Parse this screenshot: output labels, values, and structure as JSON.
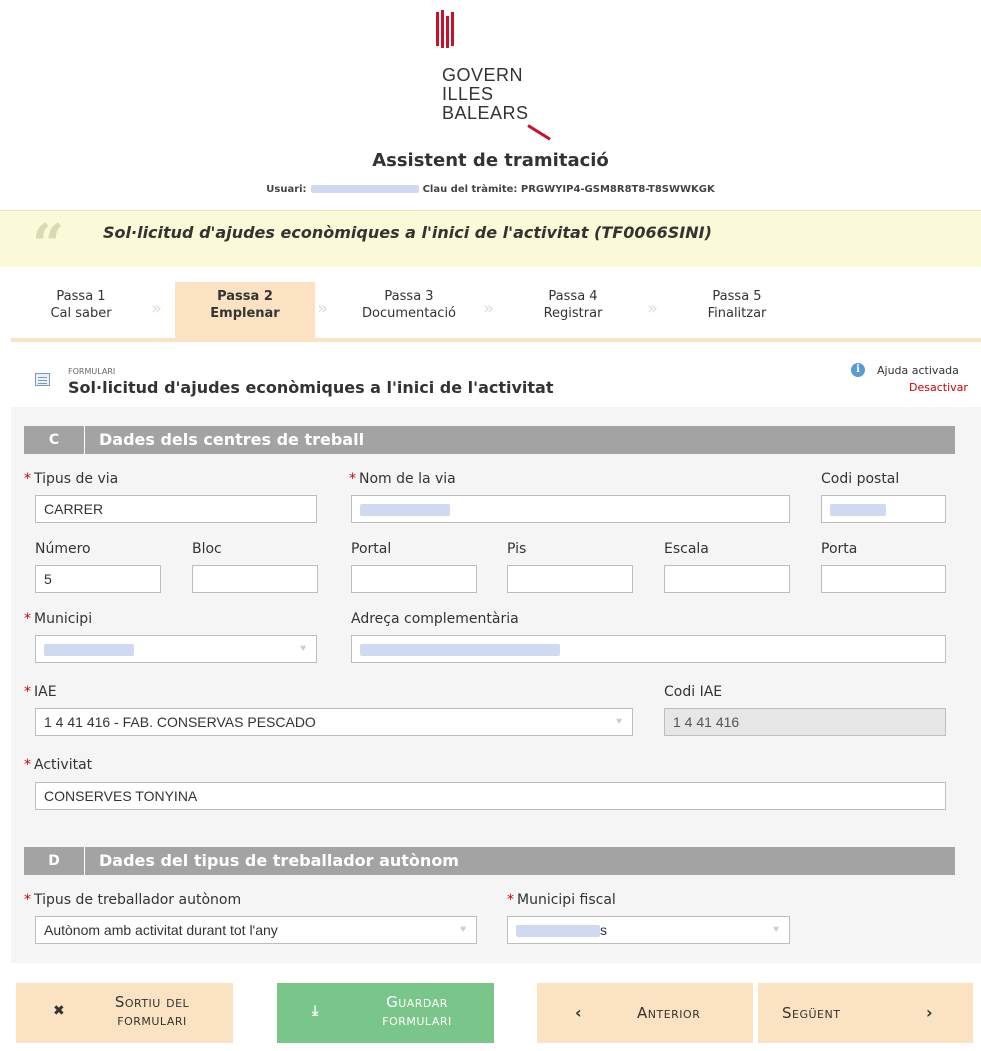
{
  "logo": {
    "line1": "GOVERN",
    "line2": "ILLES",
    "line3": "BALEARS"
  },
  "header": {
    "title": "Assistent de tramitació",
    "user_label": "Usuari:",
    "key_label": "Clau del tràmite:",
    "key_value": "PRGWYIP4-GSM8R8T8-T8SWWKGK"
  },
  "procedure": {
    "title": "Sol·licitud d'ajudes econòmiques a l'inici de l'activitat (TF0066SINI)"
  },
  "steps": [
    {
      "n": "Passa 1",
      "label": "Cal saber"
    },
    {
      "n": "Passa 2",
      "label": "Emplenar"
    },
    {
      "n": "Passa 3",
      "label": "Documentació"
    },
    {
      "n": "Passa 4",
      "label": "Registrar"
    },
    {
      "n": "Passa 5",
      "label": "Finalitzar"
    }
  ],
  "form": {
    "kicker": "FORMULARI",
    "title": "Sol·licitud d'ajudes econòmiques a l'inici de l'activitat",
    "help_on": "Ajuda activada",
    "help_off": "Desactivar"
  },
  "sectionC": {
    "letter": "C",
    "title": "Dades dels centres de treball",
    "labels": {
      "tipus_via": "Tipus de via",
      "nom_via": "Nom de la via",
      "codi_postal": "Codi postal",
      "numero": "Número",
      "bloc": "Bloc",
      "portal": "Portal",
      "pis": "Pis",
      "escala": "Escala",
      "porta": "Porta",
      "municipi": "Municipi",
      "adreca": "Adreça complementària",
      "iae": "IAE",
      "codi_iae": "Codi IAE",
      "activitat": "Activitat"
    },
    "values": {
      "tipus_via": "CARRER",
      "numero": "5",
      "iae": "1 4 41 416 - FAB. CONSERVAS PESCADO",
      "codi_iae": "1 4 41 416",
      "activitat": "CONSERVES TONYINA"
    }
  },
  "sectionD": {
    "letter": "D",
    "title": "Dades del tipus de treballador autònom",
    "labels": {
      "tipus": "Tipus de treballador autònom",
      "municipi_fiscal": "Municipi fiscal"
    },
    "values": {
      "tipus": "Autònom amb activitat durant tot l'any",
      "municipi_fiscal_suffix": "s"
    }
  },
  "buttons": {
    "exit_l1": "Sortiu del",
    "exit_l2": "formulari",
    "save_l1": "Guardar",
    "save_l2": "formulari",
    "prev": "Anterior",
    "next": "Següent"
  },
  "icons": {
    "exit": "close-icon",
    "save": "download-icon",
    "prev": "chevron-left-icon",
    "next": "chevron-right-icon",
    "help": "info-icon",
    "quote": "quote-icon",
    "form": "document-icon"
  },
  "colors": {
    "brand_red": "#c8102e",
    "step_active": "#fbe2c2",
    "save_green": "#7ac58a",
    "section_gray": "#a3a3a3",
    "link_red": "#cc0000"
  }
}
